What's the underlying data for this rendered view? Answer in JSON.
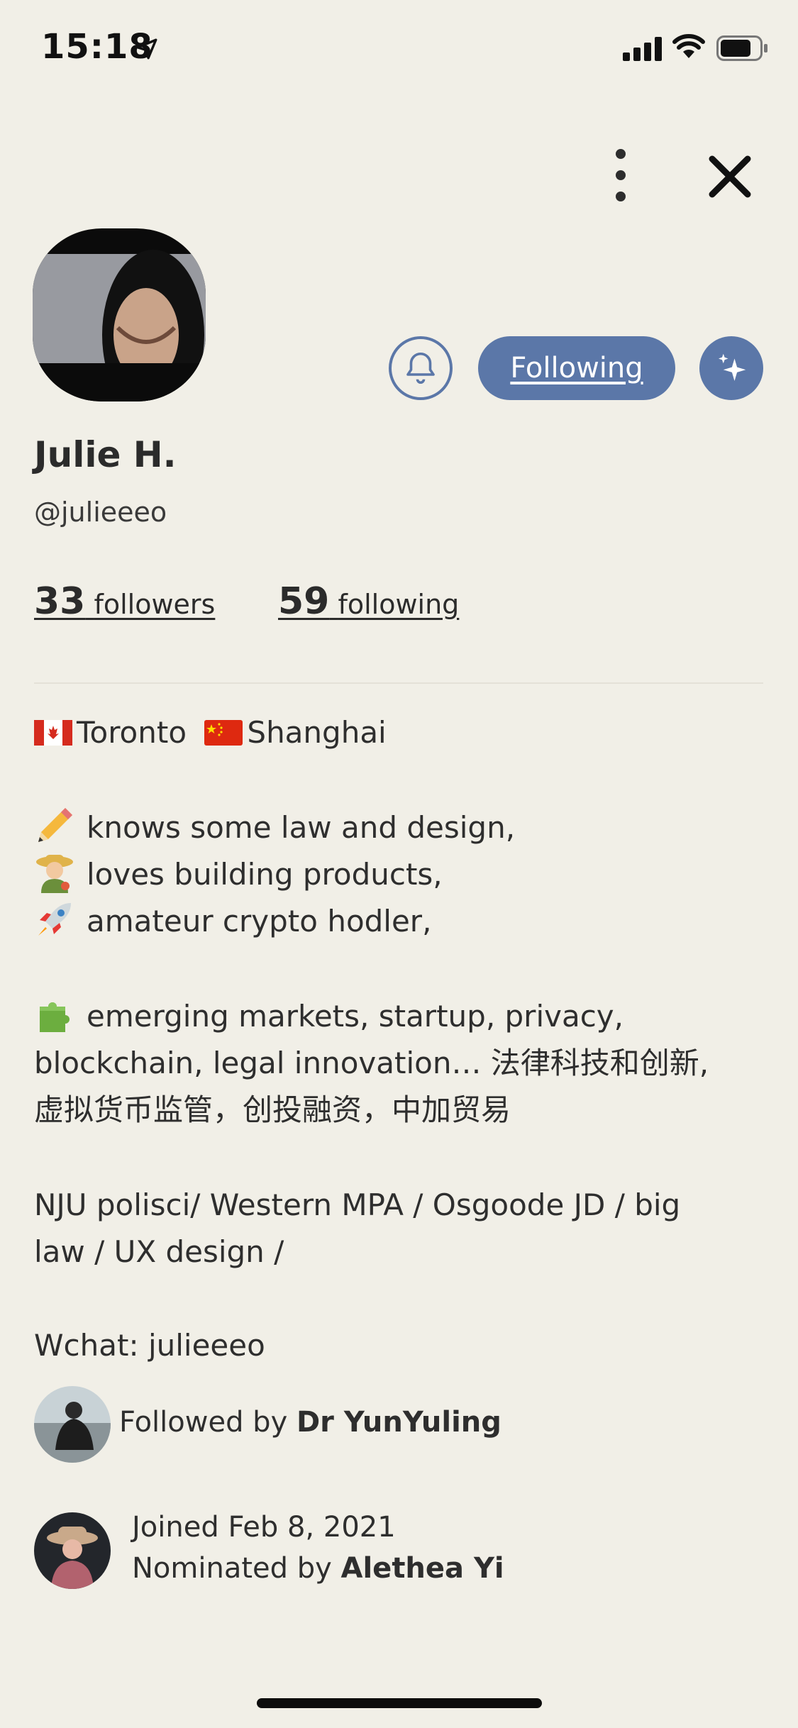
{
  "status_bar": {
    "time": "15:18"
  },
  "profile": {
    "display_name": "Julie H.",
    "username": "@julieeeo",
    "followers_count": "33",
    "followers_label": "followers",
    "following_count": "59",
    "following_label": "following",
    "follow_button_label": "Following"
  },
  "bio": {
    "location_a": "Toronto",
    "location_b": "Shanghai",
    "line1": "knows some law and design,",
    "line2": "loves building products,",
    "line3": "amateur crypto hodler,",
    "interests_line1": "emerging markets, startup, privacy,",
    "interests_line2": "blockchain, legal innovation… 法律科技和创新,",
    "interests_line3": "虚拟货币监管，创投融资，中加贸易",
    "education_line1": "NJU polisci/ Western MPA / Osgoode JD / big",
    "education_line2": "law / UX design /",
    "wechat": "Wchat: julieeeo"
  },
  "followed_by": {
    "prefix": "Followed by",
    "name": "Dr YunYuling"
  },
  "joined": {
    "date_text": "Joined Feb 8, 2021",
    "nominated_prefix": "Nominated by",
    "nominated_name": "Alethea Yi"
  },
  "colors": {
    "background": "#f1efe7",
    "accent": "#5b77a8",
    "text": "#2b2b2b"
  },
  "icons": [
    "location-arrow-icon",
    "signal-icon",
    "wifi-icon",
    "battery-icon",
    "more-vertical-icon",
    "close-icon",
    "bell-icon",
    "sparkle-icon",
    "canada-flag-icon",
    "china-flag-icon",
    "pencil-icon",
    "farmer-icon",
    "rocket-icon",
    "puzzle-icon"
  ]
}
